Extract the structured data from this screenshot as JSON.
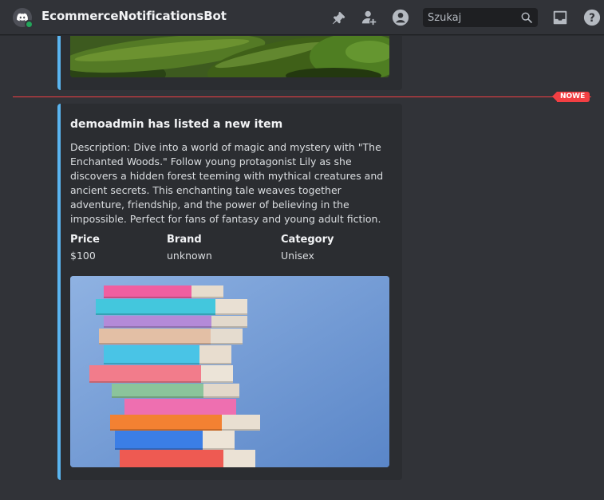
{
  "header": {
    "bot_name": "EcommerceNotificationsBot",
    "search_placeholder": "Szukaj",
    "icons": [
      "pin-icon",
      "add-member-icon",
      "profile-icon",
      "search-icon",
      "inbox-icon",
      "help-icon"
    ]
  },
  "divider": {
    "label": "NOWE"
  },
  "embed": {
    "title": "demoadmin has listed a new item",
    "description": "Description: Dive into a world of magic and mystery with \"The Enchanted Woods.\" Follow young protagonist Lily as she discovers a hidden forest teeming with mythical creatures and ancient secrets. This enchanting tale weaves together adventure, friendship, and the power of believing in the impossible. Perfect for fans of fantasy and young adult fiction.",
    "fields": [
      {
        "name": "Price",
        "value": "$100"
      },
      {
        "name": "Brand",
        "value": "unknown"
      },
      {
        "name": "Category",
        "value": "Unisex"
      }
    ]
  },
  "colors": {
    "accent_bar": "#5ab5f0",
    "new_marker": "#f23f43",
    "online_status": "#23a55a"
  }
}
